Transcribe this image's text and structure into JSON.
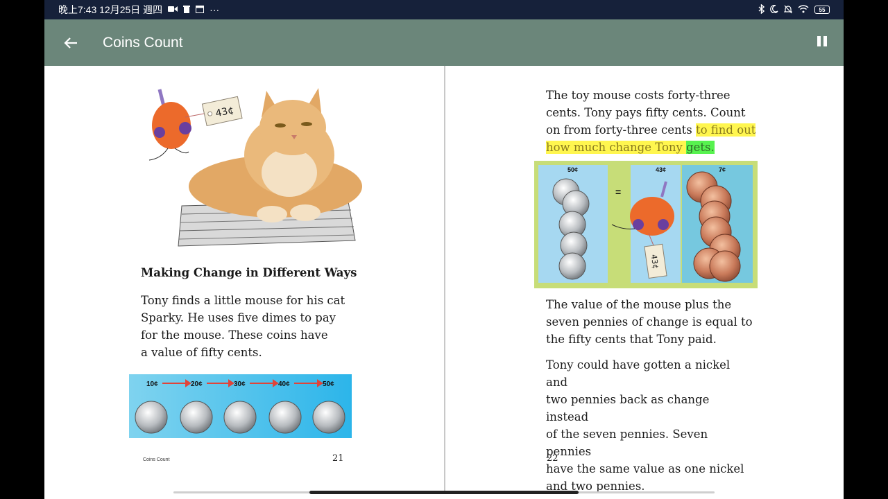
{
  "status_bar": {
    "time": "晚上7:43 12月25日 週四",
    "more": "···",
    "battery": "55"
  },
  "app_bar": {
    "title": "Coins Count"
  },
  "left_page": {
    "price_tag": "43¢",
    "heading": "Making Change in Different Ways",
    "lines": [
      "Tony finds a little mouse for his cat",
      "Sparky. He uses five dimes to pay",
      "for the mouse. These coins have",
      "a value of fifty cents."
    ],
    "dime_labels": [
      "10¢",
      "20¢",
      "30¢",
      "40¢",
      "50¢"
    ],
    "footer_title": "Coins Count",
    "page_number": "21"
  },
  "right_page": {
    "p1_lines_plain": [
      "The toy mouse costs forty-three",
      "cents. Tony pays fifty cents. Count",
      "on from forty-three cents "
    ],
    "p1_highlight_a": "to find out",
    "p1_highlight_b": "how much change Tony ",
    "p1_highlight_word": "gets.",
    "equation_labels": {
      "left": "50¢",
      "middle": "43¢",
      "right": "7¢",
      "equals": "="
    },
    "equation_tag": "43¢",
    "p2_lines": [
      "The value of the mouse plus the",
      "seven pennies of change is equal to",
      "the fifty cents that Tony paid."
    ],
    "p3_lines": [
      "Tony could have gotten a nickel and",
      "two pennies back as change instead",
      "of the seven pennies. Seven pennies",
      "have the same value as one nickel",
      "and two pennies."
    ],
    "page_number": "22"
  },
  "colors": {
    "app_bar": "#6b867a",
    "status_bar": "#16213a",
    "highlight": "#fff64f",
    "highlight_word": "#57f24f"
  }
}
